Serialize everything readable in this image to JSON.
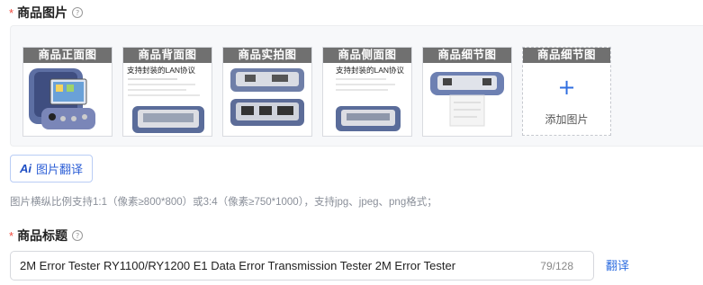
{
  "product_images": {
    "required_mark": "*",
    "label": "商品图片",
    "help_icon": "help-circle-icon",
    "thumbnails": [
      {
        "label": "商品正面图",
        "image": "handheld-tester-front"
      },
      {
        "label": "商品背面图",
        "image": "tester-back-with-text",
        "caption": "支持封装的LAN协议"
      },
      {
        "label": "商品实拍图",
        "image": "two-testers-photo"
      },
      {
        "label": "商品侧面图",
        "image": "tester-side-with-text",
        "caption": "支持封装的LAN协议"
      },
      {
        "label": "商品细节图",
        "image": "tester-detail-printer"
      }
    ],
    "add_slot": {
      "label": "商品细节图",
      "plus": "+",
      "text": "添加图片"
    }
  },
  "ai_translate_button": {
    "icon_text": "Ai",
    "label": "图片翻译"
  },
  "image_hint": "图片横纵比例支持1:1（像素≥800*800）或3:4（像素≥750*1000），支持jpg、jpeg、png格式；",
  "product_title": {
    "required_mark": "*",
    "label": "商品标题",
    "help_icon": "help-circle-icon",
    "value": "2M Error Tester RY1100/RY1200 E1 Data Error Transmission Tester 2M Error Tester",
    "counter": "79/128",
    "translate_label": "翻译"
  },
  "colors": {
    "accent": "#2f6ee0",
    "required": "#f04a3e",
    "thumb_label_bg": "#707070"
  }
}
